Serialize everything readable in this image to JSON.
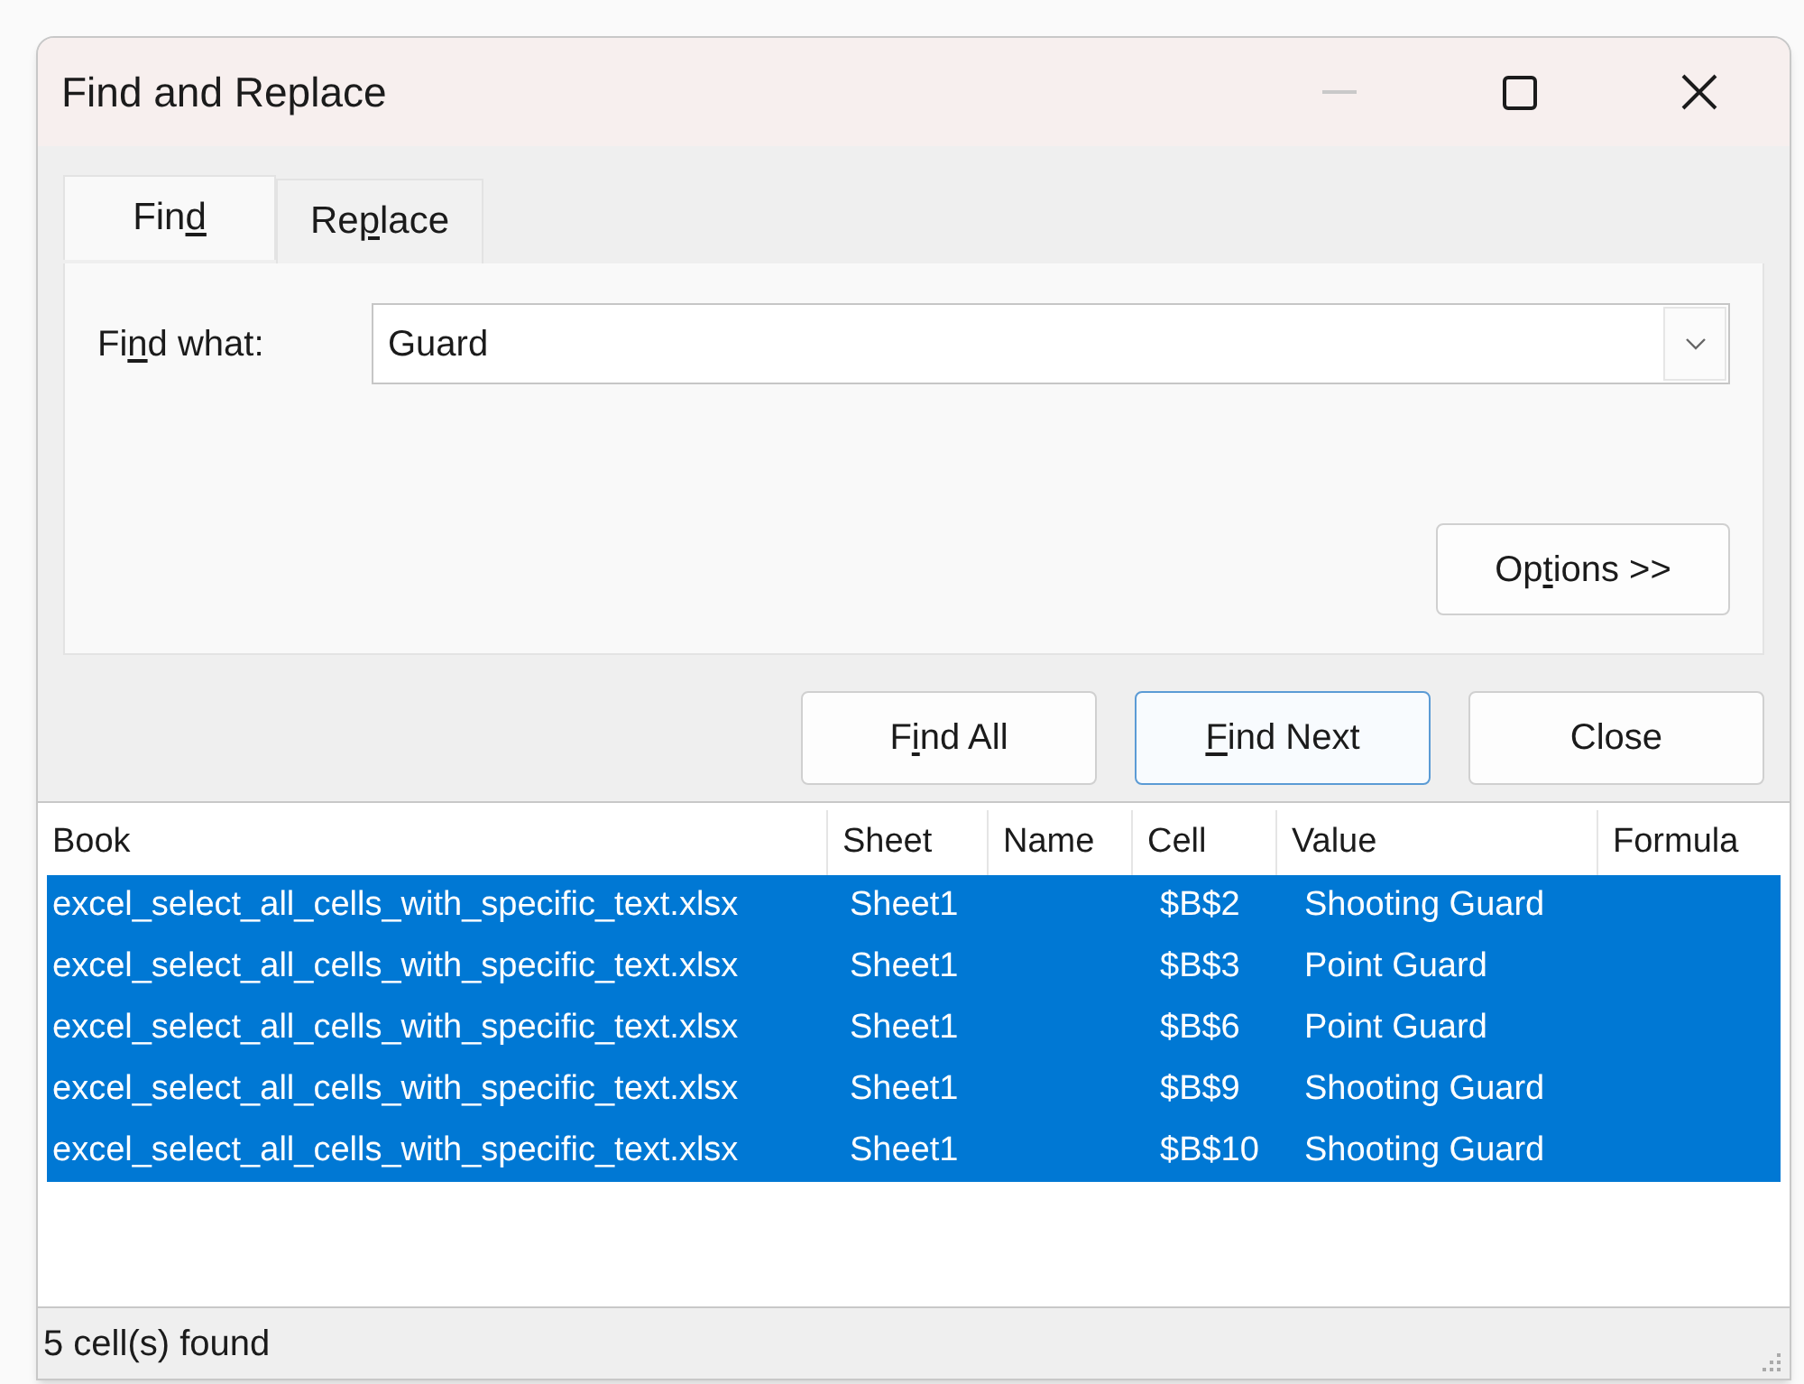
{
  "window": {
    "title": "Find and Replace",
    "minimize_disabled": true
  },
  "tabs": [
    {
      "label": {
        "pre": "Fin",
        "key": "d"
      },
      "selected": true
    },
    {
      "label": {
        "pre": "Re",
        "key": "p",
        "post": "lace"
      },
      "selected": false
    }
  ],
  "find_what": {
    "label": {
      "pre": "Fi",
      "key": "n",
      "post": "d what:"
    },
    "value": "Guard"
  },
  "options_button": {
    "label": {
      "pre": "Op",
      "key": "t",
      "post": "ions >>"
    }
  },
  "buttons": [
    {
      "label": {
        "pre": "F",
        "key": "i",
        "post": "nd All"
      },
      "focused": false
    },
    {
      "label": {
        "key": "F",
        "post": "ind Next"
      },
      "focused": true
    },
    {
      "label": {
        "pre": "Close"
      },
      "focused": false
    }
  ],
  "results": {
    "columns": [
      "Book",
      "Sheet",
      "Name",
      "Cell",
      "Value",
      "Formula"
    ],
    "rows": [
      {
        "book": "excel_select_all_cells_with_specific_text.xlsx",
        "sheet": "Sheet1",
        "cell": "$B$2",
        "value": "Shooting Guard",
        "selected": true
      },
      {
        "book": "excel_select_all_cells_with_specific_text.xlsx",
        "sheet": "Sheet1",
        "cell": "$B$3",
        "value": "Point Guard",
        "selected": true
      },
      {
        "book": "excel_select_all_cells_with_specific_text.xlsx",
        "sheet": "Sheet1",
        "cell": "$B$6",
        "value": "Point Guard",
        "selected": true
      },
      {
        "book": "excel_select_all_cells_with_specific_text.xlsx",
        "sheet": "Sheet1",
        "cell": "$B$9",
        "value": "Shooting Guard",
        "selected": true
      },
      {
        "book": "excel_select_all_cells_with_specific_text.xlsx",
        "sheet": "Sheet1",
        "cell": "$B$10",
        "value": "Shooting Guard",
        "selected": true
      }
    ]
  },
  "status_bar": "5 cell(s) found"
}
